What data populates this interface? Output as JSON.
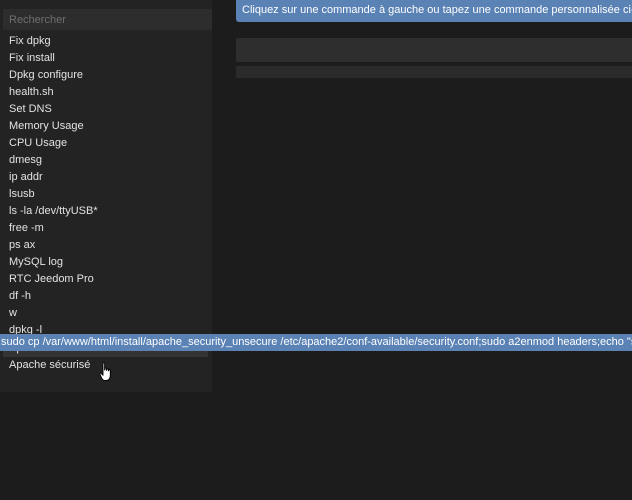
{
  "search": {
    "placeholder": "Rechercher"
  },
  "commands": [
    "Fix dpkg",
    "Fix install",
    "Dpkg configure",
    "health.sh",
    "Set DNS",
    "Memory Usage",
    "CPU Usage",
    "dmesg",
    "ip addr",
    "lsusb",
    "ls -la /dev/ttyUSB*",
    "free -m",
    "ps ax",
    "MySQL log",
    "RTC Jeedom Pro",
    "df -h",
    "w",
    "dpkg -l"
  ],
  "commands_bottom": [
    "Apache non securisé",
    "Apache sécurisé"
  ],
  "tooltip": {
    "text": "sudo cp /var/www/html/install/apache_security_unsecure /etc/apache2/conf-available/security.conf;sudo a2enmod headers;echo \"sys"
  },
  "banner": {
    "text": "Cliquez sur une commande à gauche ou tapez une commande personnalisée ci-dess"
  },
  "colors": {
    "accent": "#5a82b4",
    "background": "#1c1c1c",
    "panel": "#232323"
  }
}
